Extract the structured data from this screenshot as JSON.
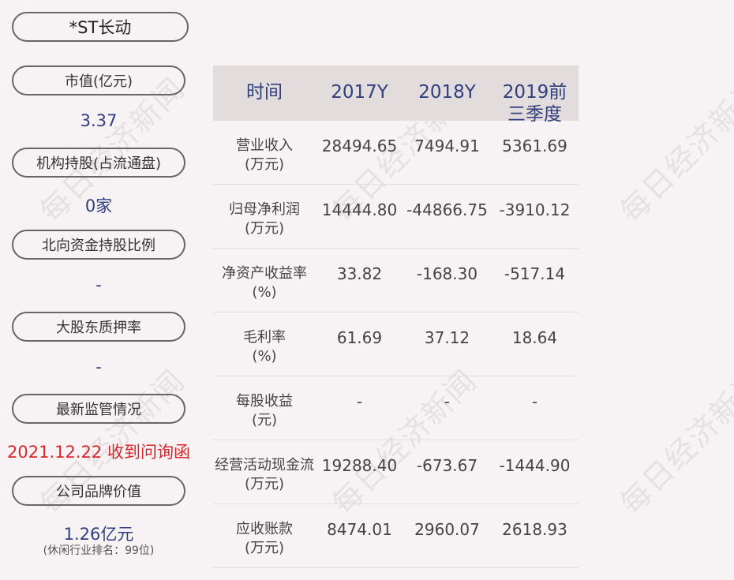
{
  "company": "*ST长动",
  "watermark_text": "每日经济新闻",
  "left": [
    {
      "label": "市值(亿元)",
      "value": "3.37"
    },
    {
      "label": "机构持股(占流通盘)",
      "value": "0家"
    },
    {
      "label": "北向资金持股比例",
      "value": "-"
    },
    {
      "label": "大股东质押率",
      "value": "-"
    },
    {
      "label": "最新监管情况",
      "value": "2021.12.22 收到问询函"
    },
    {
      "label": "公司品牌价值",
      "value": "1.26亿元",
      "note": "(休闲行业排名：99位)"
    }
  ],
  "table": {
    "headers": [
      "时间",
      "2017Y",
      "2018Y",
      "2019前三季度"
    ],
    "rows": [
      {
        "name": "营业收入",
        "unit": "(万元)",
        "values": [
          "28494.65",
          "7494.91",
          "5361.69"
        ]
      },
      {
        "name": "归母净利润",
        "unit": "(万元)",
        "values": [
          "14444.80",
          "-44866.75",
          "-3910.12"
        ]
      },
      {
        "name": "净资产收益率",
        "unit": "(%)",
        "values": [
          "33.82",
          "-168.30",
          "-517.14"
        ]
      },
      {
        "name": "毛利率",
        "unit": "(%)",
        "values": [
          "61.69",
          "37.12",
          "18.64"
        ]
      },
      {
        "name": "每股收益",
        "unit": "(元)",
        "values": [
          "-",
          "-",
          "-"
        ]
      },
      {
        "name": "经营活动现金流",
        "unit": "(万元)",
        "values": [
          "19288.40",
          "-673.67",
          "-1444.90"
        ]
      },
      {
        "name": "应收账款",
        "unit": "(万元)",
        "values": [
          "8474.01",
          "2960.07",
          "2618.93"
        ]
      }
    ]
  },
  "colors": {
    "accent": "#2f3e7e",
    "alert": "#d9262a",
    "header_bg": "#e2dcdd",
    "page_bg": "#f7f3f4"
  }
}
